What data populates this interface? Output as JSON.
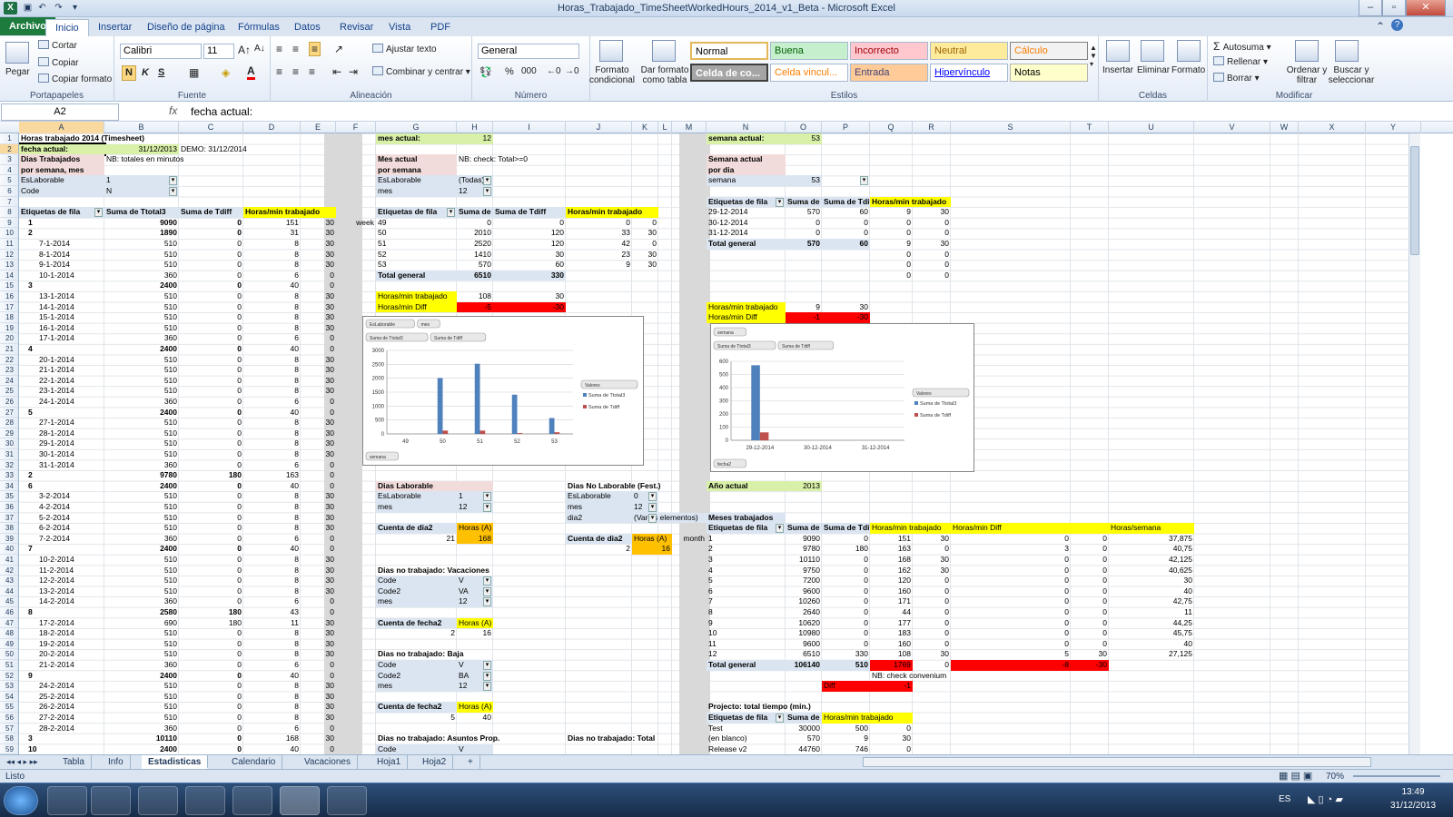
{
  "window": {
    "title": "Horas_Trabajado_TimeSheetWorkedHours_2014_v1_Beta  -  Microsoft Excel"
  },
  "ribbon": {
    "tabs": [
      "Archivo",
      "Inicio",
      "Insertar",
      "Diseño de página",
      "Fórmulas",
      "Datos",
      "Revisar",
      "Vista",
      "PDF"
    ],
    "clipboard": {
      "paste": "Pegar",
      "cut": "Cortar",
      "copy": "Copiar",
      "format": "Copiar formato",
      "label": "Portapapeles"
    },
    "font": {
      "name": "Calibri",
      "size": "11",
      "label": "Fuente",
      "bold": "N",
      "italic": "K",
      "underline": "S"
    },
    "align": {
      "wrap": "Ajustar texto",
      "merge": "Combinar y centrar",
      "label": "Alineación"
    },
    "number": {
      "format": "General",
      "label": "Número"
    },
    "styles": {
      "cond": "Formato condicional",
      "table": "Dar formato como tabla",
      "label": "Estilos",
      "cells": [
        "Normal",
        "Buena",
        "Incorrecto",
        "Neutral",
        "Cálculo",
        "Celda de co...",
        "Celda vincul...",
        "Entrada",
        "Hipervínculo",
        "Notas"
      ]
    },
    "cells": {
      "insert": "Insertar",
      "delete": "Eliminar",
      "format": "Formato",
      "label": "Celdas"
    },
    "edit": {
      "autosum": "Autosuma",
      "fill": "Rellenar",
      "clear": "Borrar",
      "sort": "Ordenar y filtrar",
      "find": "Buscar y seleccionar",
      "label": "Modificar"
    }
  },
  "formula": {
    "namebox": "A2",
    "fx": "fx",
    "content": "fecha actual:"
  },
  "columns": [
    "A",
    "B",
    "C",
    "D",
    "E",
    "F",
    "G",
    "H",
    "I",
    "J",
    "K",
    "L",
    "M",
    "N",
    "O",
    "P",
    "Q",
    "R",
    "S",
    "T",
    "U",
    "V",
    "W",
    "X",
    "Y"
  ],
  "left": {
    "title": "Horas trabajado 2014 (Timesheet)",
    "fecha_label": "fecha actual:",
    "fecha_val": "31/12/2013",
    "demo": "DEMO: 31/12/2014",
    "dias1": "Dias Trabajados",
    "nb": "NB: totales en minutos",
    "dias2": "por semana, mes",
    "f1l": "EsLaborable",
    "f1v": "1",
    "f2l": "Code",
    "f2v": "N",
    "hdr": [
      "Etiquetas de fila",
      "Suma de Ttotal3",
      "Suma de Tdiff",
      "Horas/min trabajado"
    ],
    "rows": [
      [
        "1",
        "9090",
        "0",
        "151",
        "30",
        "b"
      ],
      [
        "2",
        "1890",
        "0",
        "31",
        "30",
        "b"
      ],
      [
        "7-1-2014",
        "510",
        "0",
        "8",
        "30",
        ""
      ],
      [
        "8-1-2014",
        "510",
        "0",
        "8",
        "30",
        ""
      ],
      [
        "9-1-2014",
        "510",
        "0",
        "8",
        "30",
        ""
      ],
      [
        "10-1-2014",
        "360",
        "0",
        "6",
        "0",
        ""
      ],
      [
        "3",
        "2400",
        "0",
        "40",
        "0",
        "b"
      ],
      [
        "13-1-2014",
        "510",
        "0",
        "8",
        "30",
        ""
      ],
      [
        "14-1-2014",
        "510",
        "0",
        "8",
        "30",
        ""
      ],
      [
        "15-1-2014",
        "510",
        "0",
        "8",
        "30",
        ""
      ],
      [
        "16-1-2014",
        "510",
        "0",
        "8",
        "30",
        ""
      ],
      [
        "17-1-2014",
        "360",
        "0",
        "6",
        "0",
        ""
      ],
      [
        "4",
        "2400",
        "0",
        "40",
        "0",
        "b"
      ],
      [
        "20-1-2014",
        "510",
        "0",
        "8",
        "30",
        ""
      ],
      [
        "21-1-2014",
        "510",
        "0",
        "8",
        "30",
        ""
      ],
      [
        "22-1-2014",
        "510",
        "0",
        "8",
        "30",
        ""
      ],
      [
        "23-1-2014",
        "510",
        "0",
        "8",
        "30",
        ""
      ],
      [
        "24-1-2014",
        "360",
        "0",
        "6",
        "0",
        ""
      ],
      [
        "5",
        "2400",
        "0",
        "40",
        "0",
        "b"
      ],
      [
        "27-1-2014",
        "510",
        "0",
        "8",
        "30",
        ""
      ],
      [
        "28-1-2014",
        "510",
        "0",
        "8",
        "30",
        ""
      ],
      [
        "29-1-2014",
        "510",
        "0",
        "8",
        "30",
        ""
      ],
      [
        "30-1-2014",
        "510",
        "0",
        "8",
        "30",
        ""
      ],
      [
        "31-1-2014",
        "360",
        "0",
        "6",
        "0",
        ""
      ],
      [
        "2",
        "9780",
        "180",
        "163",
        "0",
        "b"
      ],
      [
        "6",
        "2400",
        "0",
        "40",
        "0",
        "b"
      ],
      [
        "3-2-2014",
        "510",
        "0",
        "8",
        "30",
        ""
      ],
      [
        "4-2-2014",
        "510",
        "0",
        "8",
        "30",
        ""
      ],
      [
        "5-2-2014",
        "510",
        "0",
        "8",
        "30",
        ""
      ],
      [
        "6-2-2014",
        "510",
        "0",
        "8",
        "30",
        ""
      ],
      [
        "7-2-2014",
        "360",
        "0",
        "6",
        "0",
        ""
      ],
      [
        "7",
        "2400",
        "0",
        "40",
        "0",
        "b"
      ],
      [
        "10-2-2014",
        "510",
        "0",
        "8",
        "30",
        ""
      ],
      [
        "11-2-2014",
        "510",
        "0",
        "8",
        "30",
        ""
      ],
      [
        "12-2-2014",
        "510",
        "0",
        "8",
        "30",
        ""
      ],
      [
        "13-2-2014",
        "510",
        "0",
        "8",
        "30",
        ""
      ],
      [
        "14-2-2014",
        "360",
        "0",
        "6",
        "0",
        ""
      ],
      [
        "8",
        "2580",
        "180",
        "43",
        "0",
        "b"
      ],
      [
        "17-2-2014",
        "690",
        "180",
        "11",
        "30",
        ""
      ],
      [
        "18-2-2014",
        "510",
        "0",
        "8",
        "30",
        ""
      ],
      [
        "19-2-2014",
        "510",
        "0",
        "8",
        "30",
        ""
      ],
      [
        "20-2-2014",
        "510",
        "0",
        "8",
        "30",
        ""
      ],
      [
        "21-2-2014",
        "360",
        "0",
        "6",
        "0",
        ""
      ],
      [
        "9",
        "2400",
        "0",
        "40",
        "0",
        "b"
      ],
      [
        "24-2-2014",
        "510",
        "0",
        "8",
        "30",
        ""
      ],
      [
        "25-2-2014",
        "510",
        "0",
        "8",
        "30",
        ""
      ],
      [
        "26-2-2014",
        "510",
        "0",
        "8",
        "30",
        ""
      ],
      [
        "27-2-2014",
        "510",
        "0",
        "8",
        "30",
        ""
      ],
      [
        "28-2-2014",
        "360",
        "0",
        "6",
        "0",
        ""
      ],
      [
        "3",
        "10110",
        "0",
        "168",
        "30",
        "b"
      ],
      [
        "10",
        "2400",
        "0",
        "40",
        "0",
        "b"
      ]
    ]
  },
  "mes": {
    "label": "mes actual:",
    "value": "12",
    "t1": "Mes actual",
    "nb": "NB: check: Total>=0",
    "t2": "por semana",
    "f1l": "EsLaborable",
    "f1v": "(Todas)",
    "f2l": "mes",
    "f2v": "12",
    "week": "week",
    "hdr": [
      "Etiquetas de fila",
      "Suma de Ttotal3",
      "Suma de Tdiff",
      "Horas/min trabajado"
    ],
    "rows": [
      [
        "49",
        "0",
        "0",
        "0",
        "0"
      ],
      [
        "50",
        "2010",
        "120",
        "33",
        "30"
      ],
      [
        "51",
        "2520",
        "120",
        "42",
        "0"
      ],
      [
        "52",
        "1410",
        "30",
        "23",
        "30"
      ],
      [
        "53",
        "570",
        "60",
        "9",
        "30"
      ]
    ],
    "total": [
      "Total general",
      "6510",
      "330"
    ],
    "hm_label": "Horas/min trabajado",
    "hm_h": "108",
    "hm_m": "30",
    "hd_label": "Horas/min Diff",
    "hd_h": "-5",
    "hd_m": "-30"
  },
  "semana": {
    "label": "semana actual:",
    "value": "53",
    "t1": "Semana actual",
    "t2": "por dia",
    "fl": "semana",
    "fv": "53",
    "hdr": [
      "Etiquetas de fila",
      "Suma de Ttotal3",
      "Suma de Tdiff",
      "Horas/min trabajado"
    ],
    "rows": [
      [
        "29-12-2014",
        "570",
        "60",
        "9",
        "30"
      ],
      [
        "30-12-2014",
        "0",
        "0",
        "0",
        "0"
      ],
      [
        "31-12-2014",
        "0",
        "0",
        "0",
        "0"
      ]
    ],
    "total": [
      "Total general",
      "570",
      "60",
      "9",
      "30"
    ],
    "extra": [
      [
        "0",
        "0"
      ],
      [
        "0",
        "0"
      ],
      [
        "0",
        "0"
      ]
    ],
    "hm_label": "Horas/min trabajado",
    "hm_h": "9",
    "hm_m": "30",
    "hd_label": "Horas/min Diff",
    "hd_h": "-1",
    "hd_m": "-30"
  },
  "laborable": {
    "t": "Dias Laborable",
    "f1l": "EsLaborable",
    "f1v": "1",
    "f2l": "mes",
    "f2v": "12",
    "cnt": "Cuenta de dia2",
    "hrs": "Horas (A)",
    "n": "21",
    "h": "168",
    "t2": "Dias No Laborable (Fest.)",
    "g1l": "EsLaborable",
    "g1v": "0",
    "g2l": "mes",
    "g2v": "12",
    "g3l": "dia2",
    "g3v": "(Varios elementos)",
    "n2": "2",
    "h2": "16"
  },
  "vacaciones": {
    "t": "Dias no trabajado: Vacaciones",
    "l1": "Code",
    "v1": "V",
    "l2": "Code2",
    "v2": "VA",
    "l3": "mes",
    "v3": "12",
    "cnt": "Cuenta de fecha2",
    "hrs": "Horas (A)",
    "n": "2",
    "h": "16"
  },
  "baja": {
    "t": "Dias no trabajado: Baja",
    "l1": "Code",
    "v1": "V",
    "l2": "Code2",
    "v2": "BA",
    "l3": "mes",
    "v3": "12",
    "cnt": "Cuenta de fecha2",
    "hrs": "Horas (A)",
    "n": "5",
    "h": "40"
  },
  "asuntos": {
    "t": "Dias no trabajado: Asuntos Prop.",
    "l1": "Code",
    "v1": "V",
    "t2": "Dias no trabajado: Total"
  },
  "anio": {
    "label": "Año actual",
    "value": "2013"
  },
  "meses": {
    "t": "Meses trabajados",
    "month": "month",
    "hdr": [
      "Etiquetas de fila",
      "Suma de Ttotal3",
      "Suma de Tdiff",
      "Horas/min trabajado",
      "Horas/min Diff",
      "Horas/semana"
    ],
    "rows": [
      [
        "1",
        "9090",
        "0",
        "151",
        "30",
        "0",
        "0",
        "37,875"
      ],
      [
        "2",
        "9780",
        "180",
        "163",
        "0",
        "3",
        "0",
        "40,75"
      ],
      [
        "3",
        "10110",
        "0",
        "168",
        "30",
        "0",
        "0",
        "42,125"
      ],
      [
        "4",
        "9750",
        "0",
        "162",
        "30",
        "0",
        "0",
        "40,625"
      ],
      [
        "5",
        "7200",
        "0",
        "120",
        "0",
        "0",
        "0",
        "30"
      ],
      [
        "6",
        "9600",
        "0",
        "160",
        "0",
        "0",
        "0",
        "40"
      ],
      [
        "7",
        "10260",
        "0",
        "171",
        "0",
        "0",
        "0",
        "42,75"
      ],
      [
        "8",
        "2640",
        "0",
        "44",
        "0",
        "0",
        "0",
        "11"
      ],
      [
        "9",
        "10620",
        "0",
        "177",
        "0",
        "0",
        "0",
        "44,25"
      ],
      [
        "10",
        "10980",
        "0",
        "183",
        "0",
        "0",
        "0",
        "45,75"
      ],
      [
        "11",
        "9600",
        "0",
        "160",
        "0",
        "0",
        "0",
        "40"
      ],
      [
        "12",
        "6510",
        "330",
        "108",
        "30",
        "5",
        "30",
        "27,125"
      ]
    ],
    "total": [
      "Total general",
      "106140",
      "510",
      "1769",
      "0",
      "-8",
      "-30"
    ],
    "nb": "NB: check convenium",
    "diff": "Diff",
    "diffv": "-1"
  },
  "proyecto": {
    "t": "Projecto: total tiempo (min.)",
    "hdr": [
      "Etiquetas de fila",
      "Suma de",
      "Horas/min trabajado"
    ],
    "rows": [
      [
        "Test",
        "30000",
        "500",
        "0"
      ],
      [
        "(en blanco)",
        "570",
        "9",
        "30"
      ],
      [
        "Release v2",
        "44760",
        "746",
        "0"
      ]
    ]
  },
  "chart_data": [
    {
      "type": "bar",
      "categories": [
        "49",
        "50",
        "51",
        "52",
        "53"
      ],
      "series": [
        {
          "name": "Suma de Ttotal3",
          "values": [
            0,
            2010,
            2520,
            1410,
            570
          ]
        },
        {
          "name": "Suma de Tdiff",
          "values": [
            0,
            120,
            120,
            30,
            60
          ]
        }
      ],
      "ylim": [
        0,
        3000
      ],
      "yticks": [
        "0",
        "500",
        "1000",
        "1500",
        "2000",
        "2500",
        "3000"
      ],
      "legend_title": "Valores",
      "legend": "right",
      "buttons": [
        "EsLaborable",
        "mes",
        "Suma de Ttotal3",
        "Suma de Tdiff",
        "semana"
      ],
      "colors": [
        "#4f81bd",
        "#c0504d"
      ]
    },
    {
      "type": "bar",
      "categories": [
        "29-12-2014",
        "30-12-2014",
        "31-12-2014"
      ],
      "series": [
        {
          "name": "Suma de Ttotal3",
          "values": [
            570,
            0,
            0
          ]
        },
        {
          "name": "Suma de Tdiff",
          "values": [
            60,
            0,
            0
          ]
        }
      ],
      "ylim": [
        0,
        600
      ],
      "yticks": [
        "0",
        "100",
        "200",
        "300",
        "400",
        "500",
        "600"
      ],
      "legend_title": "Valores",
      "legend": "right",
      "buttons": [
        "semana",
        "Suma de Ttotal3",
        "Suma de Tdiff",
        "fecha2"
      ],
      "colors": [
        "#4f81bd",
        "#c0504d"
      ]
    }
  ],
  "sheets": [
    "Tabla",
    "Info",
    "Estadisticas",
    "Calendario",
    "Vacaciones",
    "Hoja1",
    "Hoja2"
  ],
  "status": {
    "ready": "Listo",
    "zoom": "70%"
  },
  "taskbar": {
    "lang": "ES",
    "time": "13:49",
    "date": "31/12/2013"
  }
}
